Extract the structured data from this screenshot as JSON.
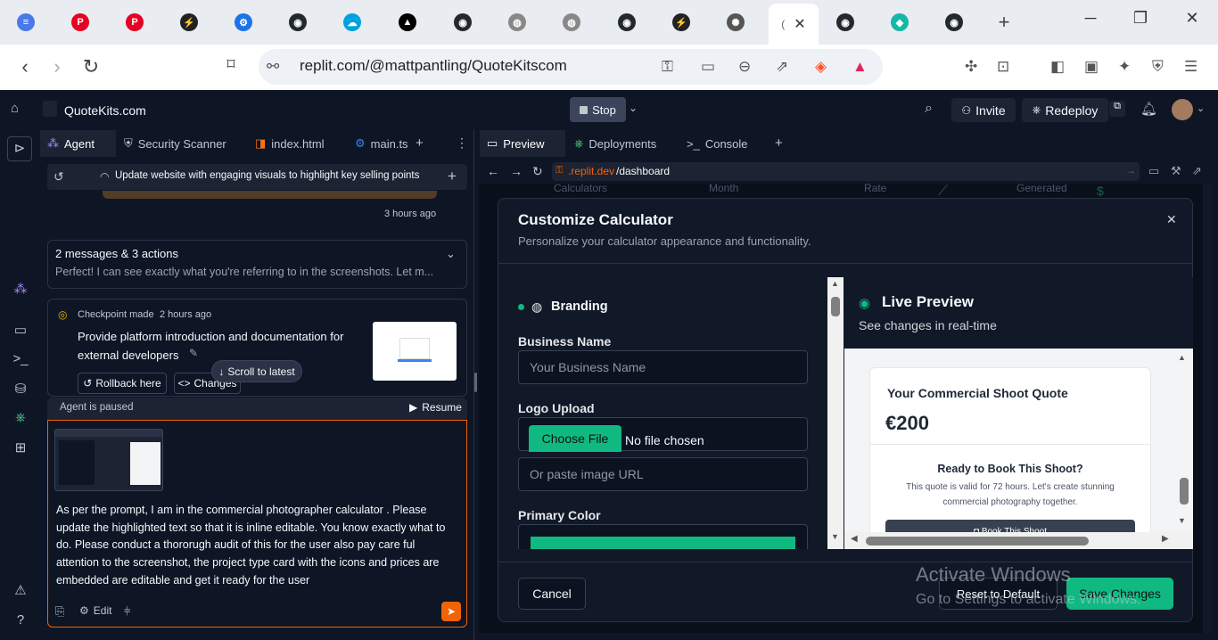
{
  "browser": {
    "url": "replit.com/@mattpantling/QuoteKitscom",
    "active_tab_label": "(",
    "new_tab": "+"
  },
  "replit": {
    "project_name": "QuoteKits.com",
    "stop_label": "Stop",
    "invite_label": "Invite",
    "redeploy_label": "Redeploy"
  },
  "left_tabs": [
    "Agent",
    "Security Scanner",
    "index.html",
    "main.ts"
  ],
  "agent": {
    "thread_title": "Update website with engaging visuals to highlight key selling points",
    "time_ago": "3 hours ago",
    "messages_summary": "2 messages & 3 actions",
    "messages_preview": "Perfect! I can see exactly what you're referring to in the screenshots. Let m...",
    "checkpoint_label": "Checkpoint made",
    "checkpoint_time": "2 hours ago",
    "checkpoint_title": "Provide platform introduction and documentation for external developers",
    "rollback_label": "Rollback here",
    "changes_label": "Changes",
    "scroll_latest": "Scroll to latest",
    "paused_label": "Agent is paused",
    "resume_label": "Resume",
    "prompt_text": "As per the prompt, I am in the commercial photographer calculator . Please update the highlighted text so that it is inline editable. You know exactly what to do. Please conduct a thororugh audit of this for the user also pay care ful attention to the screenshot, the project type card with the icons and prices are embedded are editable and get it ready for the user",
    "edit_label": "Edit"
  },
  "right_tabs": [
    "Preview",
    "Deployments",
    "Console"
  ],
  "preview": {
    "url_prefix": ".replit.dev",
    "url_path": "/dashboard",
    "bg_labels": [
      "Calculators",
      "Month",
      "Rate",
      "Generated"
    ]
  },
  "modal": {
    "title": "Customize Calculator",
    "subtitle": "Personalize your calculator appearance and functionality.",
    "branding_label": "Branding",
    "business_name_label": "Business Name",
    "business_name_placeholder": "Your Business Name",
    "logo_label": "Logo Upload",
    "choose_file": "Choose File",
    "no_file": "No file chosen",
    "image_url_placeholder": "Or paste image URL",
    "primary_color_label": "Primary Color",
    "primary_color": "#10b981",
    "live_preview_title": "Live Preview",
    "live_preview_sub": "See changes in real-time",
    "quote_title": "Your Commercial Shoot Quote",
    "quote_price": "€200",
    "book_heading": "Ready to Book This Shoot?",
    "book_text": "This quote is valid for 72 hours. Let's create stunning commercial photography together.",
    "book_button": "Book This Shoot",
    "cancel_label": "Cancel",
    "reset_label": "Reset to Default",
    "save_label": "Save Changes"
  },
  "watermark": {
    "line1": "Activate Windows",
    "line2": "Go to Settings to activate Windows."
  },
  "colors": {
    "accent": "#10b981",
    "brand_orange": "#f26207"
  }
}
